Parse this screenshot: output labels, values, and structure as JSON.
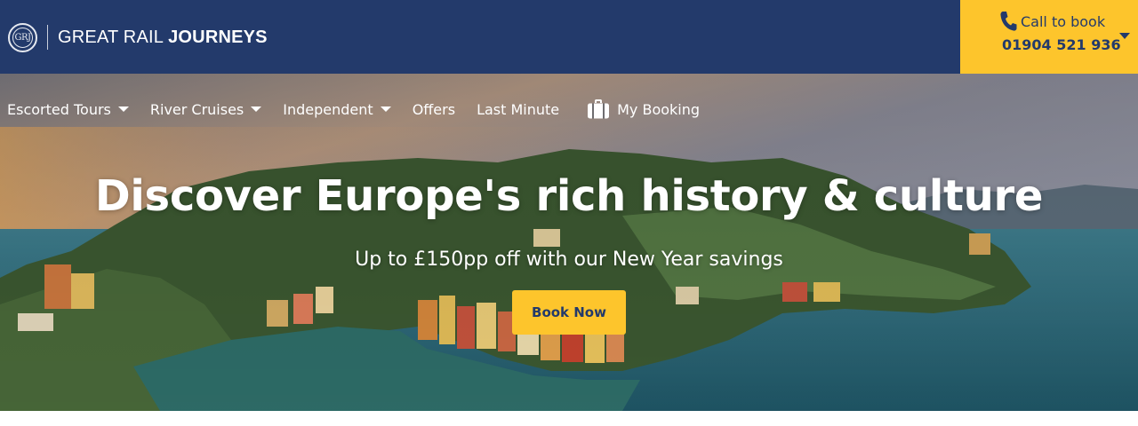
{
  "brand": {
    "logo_mark": "GRJ",
    "name_part1": "GREAT RAIL",
    "name_part2": "JOURNEYS"
  },
  "call": {
    "label": "Call to book",
    "number": "01904 521 936",
    "icon": "phone-icon"
  },
  "nav": {
    "items": [
      {
        "label": "Escorted Tours",
        "dropdown": true
      },
      {
        "label": "River Cruises",
        "dropdown": true
      },
      {
        "label": "Independent",
        "dropdown": true
      },
      {
        "label": "Offers",
        "dropdown": false
      },
      {
        "label": "Last Minute",
        "dropdown": false
      }
    ],
    "booking": {
      "label": "My Booking",
      "icon": "suitcase-icon"
    }
  },
  "hero": {
    "headline": "Discover Europe's rich history & culture",
    "subline": "Up to £150pp off with our New Year savings",
    "cta": "Book Now",
    "image_subject": "coastal harbour village with colourful houses"
  },
  "colors": {
    "navy": "#233a6b",
    "yellow": "#fdc52c",
    "white": "#ffffff"
  }
}
